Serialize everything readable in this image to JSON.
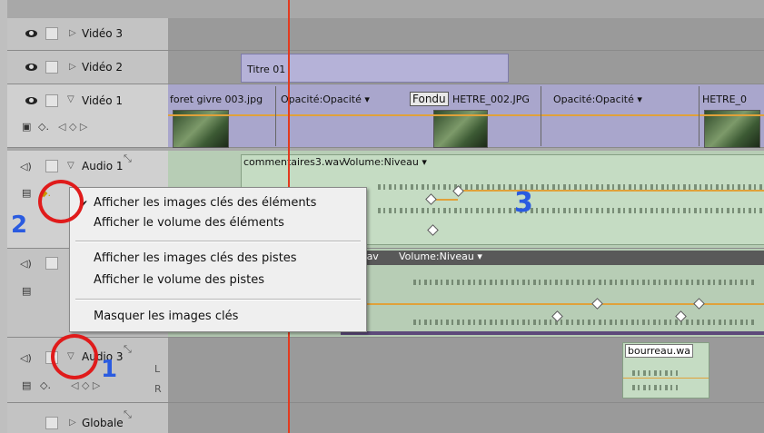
{
  "tracks": {
    "video3": {
      "name": "Vidéo 3"
    },
    "video2": {
      "name": "Vidéo 2",
      "clip_title": "Titre 01"
    },
    "video1": {
      "name": "Vidéo 1",
      "clip1": "foret givre 003.jpg",
      "clip1_fx": "Opacité:Opacité ▾",
      "transition": "Fondu",
      "clip2": "HETRE_002.JPG",
      "clip2_fx": "Opacité:Opacité ▾",
      "clip3": "HETRE_0"
    },
    "audio1": {
      "name": "Audio 1",
      "clip": "commentaires3.wav",
      "clip_fx": "Volume:Niveau ▾"
    },
    "audio2": {
      "clip": "nic.wav",
      "clip_fx": "Volume:Niveau ▾"
    },
    "audio3": {
      "name": "Audio 3",
      "clip": "bourreau.wa",
      "l_label": "L",
      "r_label": "R"
    },
    "globale": {
      "name": "Globale"
    }
  },
  "menu": {
    "item1": "Afficher les images clés des éléments",
    "item2": "Afficher le volume des éléments",
    "item3": "Afficher les images clés des pistes",
    "item4": "Afficher le volume des pistes",
    "item5": "Masquer les images clés",
    "checked": "✔"
  },
  "annotations": {
    "n1": "1",
    "n2": "2",
    "n3": "3"
  },
  "colors": {
    "playhead": "#e23a1f",
    "annotation_circle": "#e01b1b",
    "annotation_number": "#2a5be0",
    "video_clip": "#b5b2d8",
    "audio_clip": "#c5dcc3",
    "volume_line": "#e0a13a"
  }
}
